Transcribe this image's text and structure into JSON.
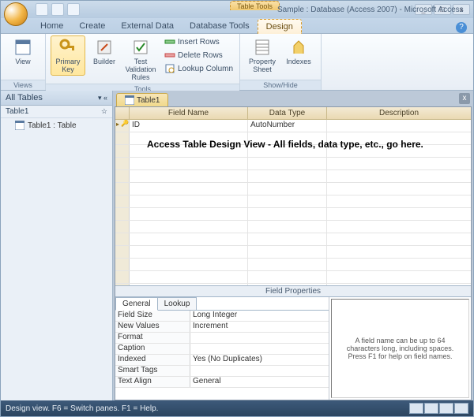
{
  "title": "Sample : Database (Access 2007) - Microsoft Access",
  "contextual_tab": "Table Tools",
  "tabs": {
    "home": "Home",
    "create": "Create",
    "external": "External Data",
    "dbtools": "Database Tools",
    "design": "Design"
  },
  "ribbon": {
    "views": {
      "label": "Views",
      "view": "View"
    },
    "tools": {
      "label": "Tools",
      "pk": "Primary Key",
      "builder": "Builder",
      "test": "Test Validation Rules",
      "insert": "Insert Rows",
      "delete": "Delete Rows",
      "lookup": "Lookup Column"
    },
    "showhide": {
      "label": "Show/Hide",
      "sheet": "Property Sheet",
      "indexes": "Indexes"
    }
  },
  "nav": {
    "header": "All Tables",
    "group": "Table1",
    "item": "Table1 : Table"
  },
  "doc": {
    "tab": "Table1"
  },
  "grid": {
    "headers": {
      "fn": "Field Name",
      "dt": "Data Type",
      "desc": "Description"
    },
    "row": {
      "fn": "ID",
      "dt": "AutoNumber"
    },
    "overlay": "Access Table Design View - All fields, data type, etc., go here."
  },
  "props": {
    "label": "Field Properties",
    "tabs": {
      "general": "General",
      "lookup": "Lookup"
    },
    "rows": [
      {
        "n": "Field Size",
        "v": "Long Integer"
      },
      {
        "n": "New Values",
        "v": "Increment"
      },
      {
        "n": "Format",
        "v": ""
      },
      {
        "n": "Caption",
        "v": ""
      },
      {
        "n": "Indexed",
        "v": "Yes (No Duplicates)"
      },
      {
        "n": "Smart Tags",
        "v": ""
      },
      {
        "n": "Text Align",
        "v": "General"
      }
    ],
    "help": "A field name can be up to 64 characters long, including spaces.  Press F1 for help on field names."
  },
  "status": "Design view.  F6 = Switch panes.  F1 = Help."
}
